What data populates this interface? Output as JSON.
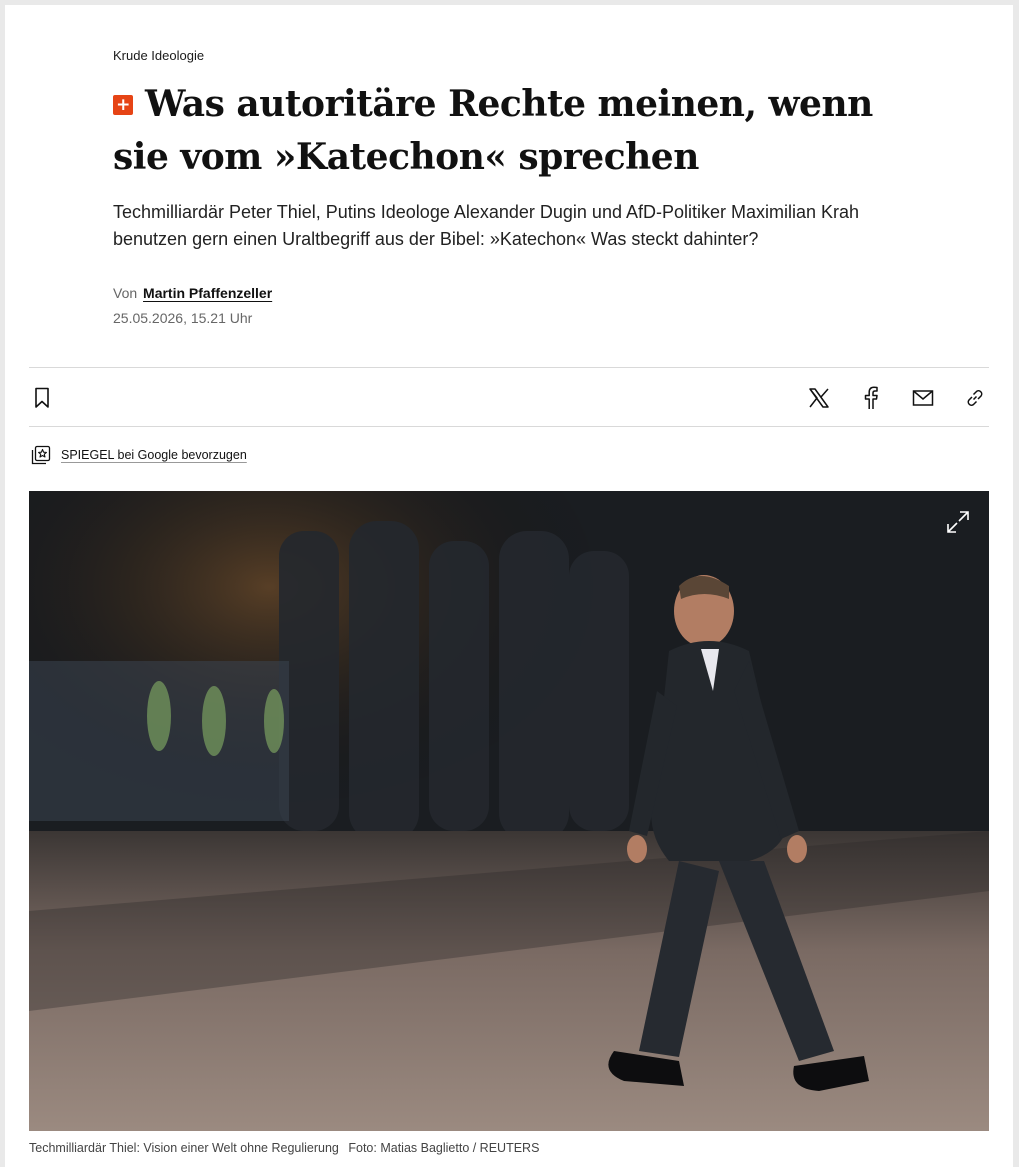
{
  "article": {
    "kicker": "Krude Ideologie",
    "headline": "Was autoritäre Rechte meinen, wenn sie vom »Katechon« sprechen",
    "plus_badge": "+",
    "teaser": "Techmilliardär Peter Thiel, Putins Ideologe Alexander Dugin und AfD-Politiker Maximilian Krah benutzen gern einen Uraltbegriff aus der Bibel: »Katechon« Was steckt dahinter?",
    "byline_prefix": "Von",
    "author": "Martin Pfaffenzeller",
    "date": "25.05.2026, 15.21 Uhr"
  },
  "toolbar": {
    "bookmark_icon": "bookmark-icon",
    "share_icons": [
      "x-icon",
      "facebook-icon",
      "mail-icon",
      "link-icon"
    ]
  },
  "google_pref": {
    "label": "SPIEGEL bei Google bevorzugen",
    "icon": "star-stack-icon"
  },
  "hero": {
    "caption": "Techmilliardär Thiel: Vision einer Welt ohne Regulierung",
    "credit": "Foto: Matias Baglietto / REUTERS",
    "expand_icon": "expand-icon"
  },
  "colors": {
    "plus_accent": "#e64415",
    "text": "#111111",
    "muted": "#666666",
    "divider": "#d9d9d9"
  }
}
